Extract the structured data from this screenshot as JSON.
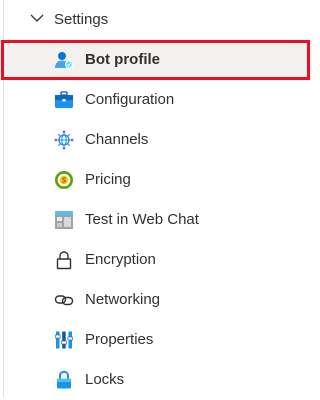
{
  "settings": {
    "title": "Settings",
    "items": [
      {
        "label": "Bot profile",
        "icon": "bot-profile-icon",
        "selected": true
      },
      {
        "label": "Configuration",
        "icon": "configuration-icon"
      },
      {
        "label": "Channels",
        "icon": "channels-icon"
      },
      {
        "label": "Pricing",
        "icon": "pricing-icon"
      },
      {
        "label": "Test in Web Chat",
        "icon": "web-chat-icon"
      },
      {
        "label": "Encryption",
        "icon": "lock-icon"
      },
      {
        "label": "Networking",
        "icon": "networking-icon"
      },
      {
        "label": "Properties",
        "icon": "properties-icon"
      },
      {
        "label": "Locks",
        "icon": "locks-icon"
      }
    ]
  },
  "colors": {
    "highlight": "#e81123",
    "selected_bg": "#f3f2f1",
    "accent": "#0078d4"
  }
}
